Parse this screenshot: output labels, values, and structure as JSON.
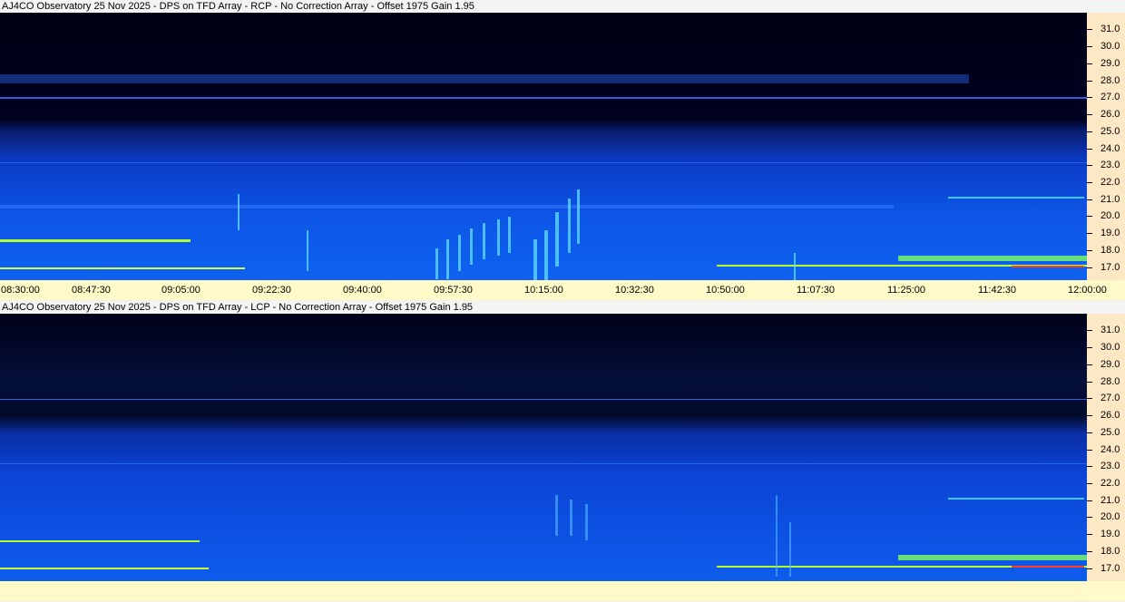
{
  "panels": [
    {
      "id": "rcp",
      "title": "AJ4CO Observatory 25 Nov 2025 - DPS on TFD Array  - RCP  -  No Correction Array  -  Offset 1975  Gain 1.95",
      "y_ticks": [
        "31.0",
        "30.0",
        "29.0",
        "28.0",
        "27.0",
        "26.0",
        "25.0",
        "24.0",
        "23.0",
        "22.0",
        "21.0",
        "20.0",
        "19.0",
        "18.0",
        "17.0"
      ],
      "x_ticks": [
        "08:30:00",
        "08:47:30",
        "09:05:00",
        "09:22:30",
        "09:40:00",
        "09:57:30",
        "10:15:00",
        "10:32:30",
        "10:50:00",
        "11:07:30",
        "11:25:00",
        "11:42:30",
        "12:00:00"
      ]
    },
    {
      "id": "lcp",
      "title": "AJ4CO Observatory 25 Nov 2025 - DPS on TFD Array - LCP  -  No Correction Array  -  Offset 1975  Gain 1.95",
      "y_ticks": [
        "31.0",
        "30.0",
        "29.0",
        "28.0",
        "27.0",
        "26.0",
        "25.0",
        "24.0",
        "23.0",
        "22.0",
        "21.0",
        "20.0",
        "19.0",
        "18.0",
        "17.0"
      ],
      "x_ticks": []
    }
  ],
  "colors": {
    "background_dark": "#000014",
    "band_blue": "#0a3fd6",
    "bright_blue": "#1a78ff",
    "cyan": "#40c8ff",
    "yellow_green": "#c8ff40",
    "red": "#ff4020",
    "axis_bg": "#fde8c6",
    "time_axis_bg": "#fffac8"
  }
}
